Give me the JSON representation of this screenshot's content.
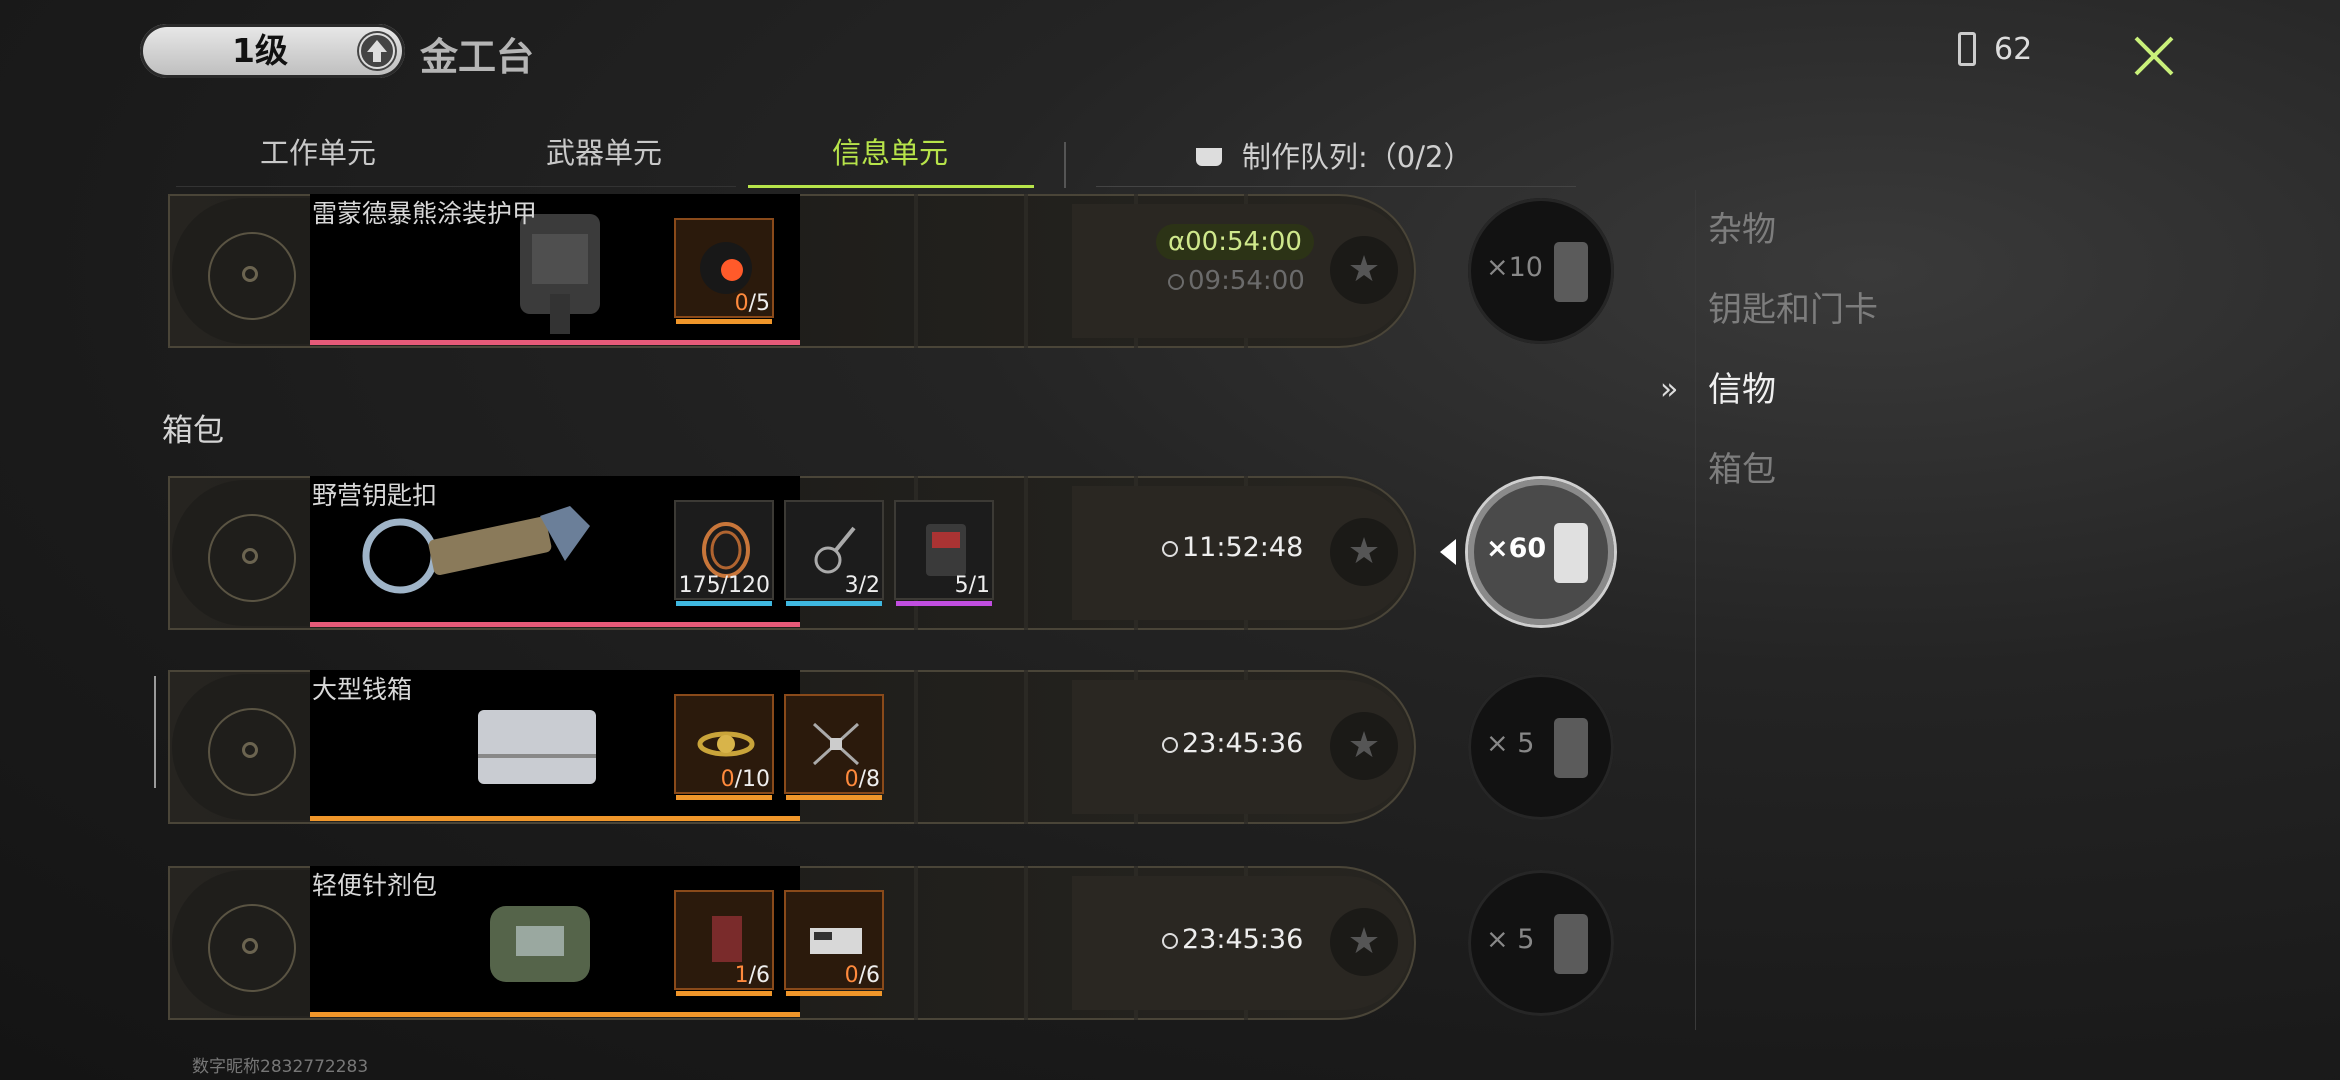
{
  "header": {
    "level": "1级",
    "bench_title": "金工台",
    "battery_count": "62",
    "close_label": ""
  },
  "tabs": [
    {
      "label": "工作单元",
      "active": false
    },
    {
      "label": "武器单元",
      "active": false
    },
    {
      "label": "信息单元",
      "active": true
    }
  ],
  "queue_label": "制作队列:（0/2）",
  "section_label": "箱包",
  "cards": [
    {
      "name": "雷蒙德暴熊涂装护甲",
      "alpha_time": "α00:54:00",
      "time": "09:54:00",
      "materials": [
        {
          "have": "0",
          "need": "/5",
          "icon": "vinyl-record-icon",
          "rarity": "orange"
        }
      ],
      "bar_color": "#e65a78",
      "cost": "×10",
      "selected": false
    },
    {
      "name": "野营钥匙扣",
      "time": "11:52:48",
      "materials": [
        {
          "have": "175",
          "need": "/120",
          "icon": "copper-wire-icon",
          "rarity": "blue"
        },
        {
          "have": "3",
          "need": "/2",
          "icon": "keyring-icon",
          "rarity": "blue"
        },
        {
          "have": "5",
          "need": "/1",
          "icon": "toolkit-icon",
          "rarity": "purple"
        }
      ],
      "bar_color": "#e65a78",
      "cost": "×60",
      "selected": true
    },
    {
      "name": "大型钱箱",
      "time": "23:45:36",
      "materials": [
        {
          "have": "0",
          "need": "/10",
          "icon": "gold-watch-icon",
          "rarity": "orange"
        },
        {
          "have": "0",
          "need": "/8",
          "icon": "drone-icon",
          "rarity": "orange"
        }
      ],
      "bar_color": "#f0962a",
      "cost": "× 5",
      "selected": false
    },
    {
      "name": "轻便针剂包",
      "time": "23:45:36",
      "materials": [
        {
          "have": "1",
          "need": "/6",
          "icon": "notebook-icon",
          "rarity": "orange"
        },
        {
          "have": "0",
          "need": "/6",
          "icon": "device-box-icon",
          "rarity": "orange"
        }
      ],
      "bar_color": "#f0962a",
      "cost": "× 5",
      "selected": false
    }
  ],
  "categories": [
    {
      "label": "杂物",
      "active": false
    },
    {
      "label": "钥匙和门卡",
      "active": false
    },
    {
      "label": "信物",
      "active": true
    },
    {
      "label": "箱包",
      "active": false
    }
  ],
  "footer": "数字昵称2832772283",
  "colors": {
    "accent": "#b7e44a",
    "rare_orange": "#f0962a",
    "rare_blue": "#3fb8e0",
    "rare_purple": "#c14ee0",
    "rare_pink": "#e65a78"
  }
}
